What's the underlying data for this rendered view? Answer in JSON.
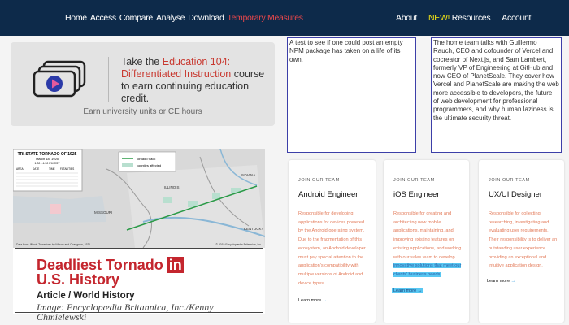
{
  "nav": {
    "left": [
      "Home",
      "Access",
      "Compare",
      "Analyse",
      "Download"
    ],
    "highlight": "Temporary Measures",
    "right": {
      "about": "About",
      "new_badge": "NEW!",
      "resources": "Resources",
      "account": "Account"
    }
  },
  "promo": {
    "pre": "Take the ",
    "course": "Education 104: Differentiated Instruction",
    "post": " course to earn continuing education credit.",
    "footer": "Earn university units or CE hours",
    "icon": "video-lessons-icon"
  },
  "map_card": {
    "title_pre": "Deadliest Tornado ",
    "title_in": "in",
    "title_post": "U.S. History",
    "subtitle": "Article / World History",
    "image_credit": "Image: Encyclopædia Britannica, Inc./Kenny Chmielewski",
    "map": {
      "heading": "TRI-STATE TORNADO OF 1925",
      "date": "March 18, 1925",
      "time": "1:00 - 4:30 PM CST",
      "legend": [
        "tornado track",
        "counties affected"
      ],
      "state_labels": [
        "ILLINOIS",
        "MISSOURI",
        "INDIANA",
        "KENTUCKY"
      ],
      "table_headers": [
        "AREA",
        "DATE",
        "TIME",
        "FATALITIES"
      ],
      "source": "Data from: Illinois Tornadoes by Wilson and Changnon, 1971",
      "copyright": "© 2019 Encyclopædia Britannica, Inc."
    }
  },
  "text_boxes": [
    "A test to see if one could post an empty NPM package has taken on a life of its own.",
    "The home team talks with Guillermo Rauch, CEO and cofounder of Vercel and cocreator of Next.js, and Sam Lambert, formerly VP of Engineering at GitHub and now CEO of PlanetScale. They cover how Vercel and PlanetScale are making the web more accessible to developers, the future of web development for professional programmers, and why human laziness is the ultimate security threat."
  ],
  "jobs": [
    {
      "eyebrow": "JOIN OUR TEAM",
      "title": "Android Engineer",
      "description": "Responsible for developing applications for devices powered by the Android operating system. Due to the fragmentation of this ecosystem, an Android developer must pay special attention to the application's compatibility with multiple versions of Android and device types.",
      "learn_more": "Learn more"
    },
    {
      "eyebrow": "JOIN OUR TEAM",
      "title": "iOS Engineer",
      "description": "Responsible for creating and architecting new mobile applications, maintaining, and improving existing features on existing applications, and working with our sales team to develop",
      "description_highlight": "innovative solutions that meet our clients' business needs.",
      "learn_more": "Learn more"
    },
    {
      "eyebrow": "JOIN OUR TEAM",
      "title": "UX/UI Designer",
      "description": "Responsible for collecting, researching, investigating and evaluating user requirements. Their responsibility is to deliver an outstanding user experience providing an exceptional and intuitive application design.",
      "learn_more": "Learn more"
    }
  ],
  "colors": {
    "nav_bg": "#0d2a4a",
    "nav_red": "#e8474a",
    "new_yellow": "#f5e614",
    "course_red": "#c8382f",
    "tornado_red": "#c4262e",
    "job_desc": "#e37b5a",
    "selection": "#58c7f2"
  }
}
